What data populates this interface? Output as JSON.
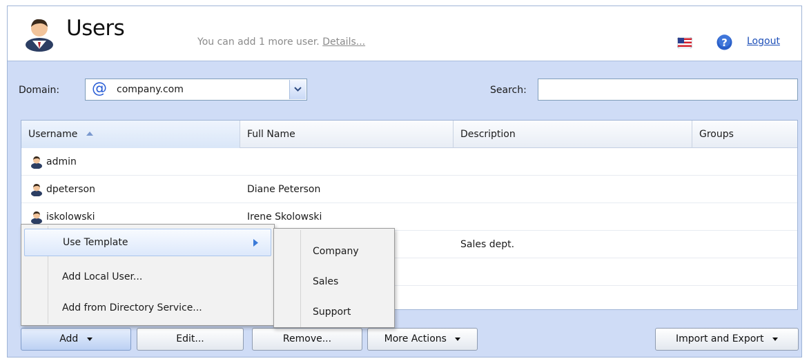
{
  "header": {
    "title": "Users",
    "user_limit_text": "You can add 1 more user.",
    "details_link": "Details...",
    "logout_label": "Logout"
  },
  "filters": {
    "domain_label": "Domain:",
    "domain_value": "company.com",
    "search_label": "Search:",
    "search_value": ""
  },
  "table": {
    "columns": [
      "Username",
      "Full Name",
      "Description",
      "Groups"
    ],
    "sorted_column": "Username",
    "rows": [
      {
        "username": "admin",
        "full_name": "",
        "description": "",
        "groups": ""
      },
      {
        "username": "dpeterson",
        "full_name": "Diane Peterson",
        "description": "",
        "groups": ""
      },
      {
        "username": "iskolowski",
        "full_name": "Irene Skolowski",
        "description": "",
        "groups": ""
      },
      {
        "username": "",
        "full_name": "",
        "description": "Sales dept.",
        "groups": ""
      },
      {
        "username": "",
        "full_name": "",
        "description": "",
        "groups": ""
      },
      {
        "username": "",
        "full_name": "",
        "description": "",
        "groups": ""
      }
    ]
  },
  "add_menu": {
    "items": [
      "Use Template",
      "Add Local User...",
      "Add from Directory Service..."
    ],
    "template_submenu": [
      "Company",
      "Sales",
      "Support"
    ]
  },
  "toolbar": {
    "add_label": "Add",
    "edit_label": "Edit...",
    "remove_label": "Remove...",
    "more_actions_label": "More Actions",
    "import_export_label": "Import and Export"
  },
  "icons": {
    "page": "users-icon",
    "row": "user-icon",
    "flag": "us-flag-icon",
    "help": "help-icon"
  },
  "colors": {
    "panel_bg": "#cfdcf6",
    "link": "#1d4fb8",
    "help_blue": "#2a5fc8"
  }
}
